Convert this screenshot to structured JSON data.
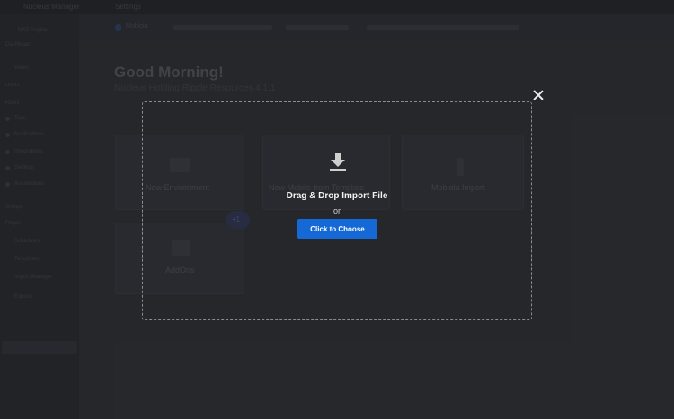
{
  "background": {
    "topbar_items": [
      "Nucleus Manager",
      "Settings"
    ],
    "sidebar_items": [
      "NSP Engine",
      "Dashboard",
      "Views",
      "Users",
      "Roles",
      "Tags",
      "Notifications",
      "Integrations",
      "Settings",
      "Automations",
      "Groups",
      "Pages",
      "Schedules",
      "Templates",
      "Import Manager",
      "Exports"
    ],
    "subbar_label": "Mobiola",
    "greeting": "Good Morning!",
    "greeting_sub": "Nucleus Holding Ripple Resources 4.1.1",
    "cards": {
      "new_environment": "New Environment",
      "new_mobile_from_template": "New Mobile from Template",
      "mobiola_import": "Mobiola Import",
      "addons": "AddOns"
    },
    "fab_label": "+1"
  },
  "modal": {
    "title": "Drag & Drop Import File",
    "or_text": "or",
    "choose_button": "Click to Choose"
  },
  "colors": {
    "accent": "#1569d6",
    "dropzone_border": "#8a8c92",
    "text_primary": "#f2f2f2"
  },
  "icons": {
    "close": "close-icon",
    "download": "download-icon"
  }
}
